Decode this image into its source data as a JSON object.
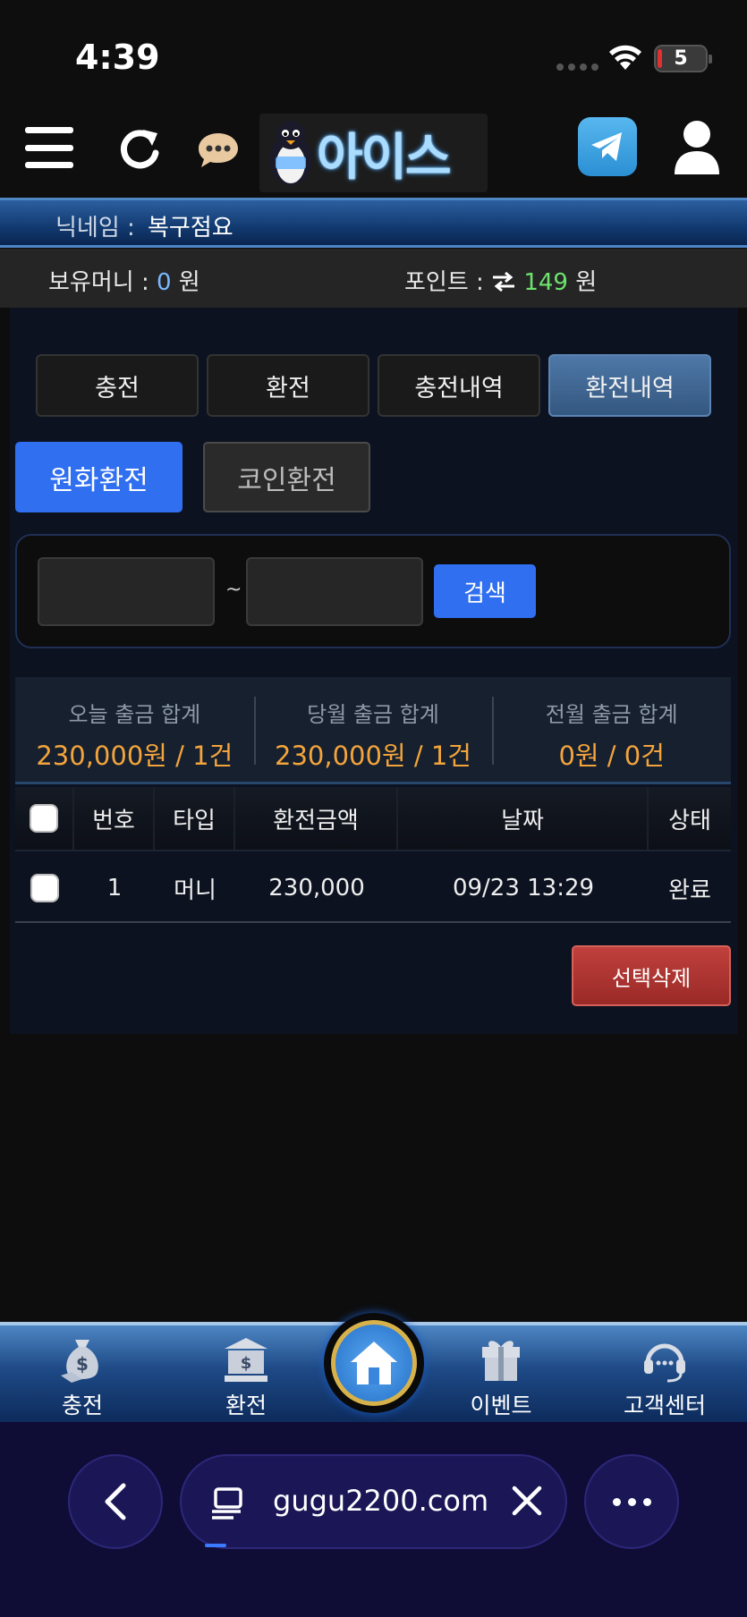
{
  "status_bar": {
    "time": "4:39",
    "battery": "5"
  },
  "header": {
    "logo_text": "아이스"
  },
  "user": {
    "nickname_label": "닉네임 :",
    "nickname": "복구점요"
  },
  "balance": {
    "money_label": "보유머니 :",
    "money_value": "0",
    "money_unit": "원",
    "point_label": "포인트 :",
    "point_value": "149",
    "point_unit": "원"
  },
  "tabs": [
    {
      "label": "충전",
      "active": false
    },
    {
      "label": "환전",
      "active": false
    },
    {
      "label": "충전내역",
      "active": false
    },
    {
      "label": "환전내역",
      "active": true
    }
  ],
  "subtabs": [
    {
      "label": "원화환전",
      "active": true
    },
    {
      "label": "코인환전",
      "active": false
    }
  ],
  "search": {
    "start_value": "",
    "separator": "~",
    "end_value": "",
    "button_label": "검색"
  },
  "summary": [
    {
      "label": "오늘 출금 합계",
      "value": "230,000원 / 1건"
    },
    {
      "label": "당월 출금 합계",
      "value": "230,000원 / 1건"
    },
    {
      "label": "전월 출금 합계",
      "value": "0원 / 0건"
    }
  ],
  "table": {
    "headers": [
      "번호",
      "타입",
      "환전금액",
      "날짜",
      "상태"
    ],
    "rows": [
      {
        "no": "1",
        "type": "머니",
        "amount": "230,000",
        "date": "09/23 13:29",
        "status": "완료"
      }
    ]
  },
  "delete_button": "선택삭제",
  "bottom_nav": {
    "items": [
      {
        "label": "충전",
        "icon": "money-bag-icon"
      },
      {
        "label": "환전",
        "icon": "bank-icon"
      },
      {
        "label": "",
        "icon": "home-icon"
      },
      {
        "label": "이벤트",
        "icon": "gift-icon"
      },
      {
        "label": "고객센터",
        "icon": "headset-icon"
      }
    ]
  },
  "browser": {
    "url": "gugu2200.com"
  },
  "colors": {
    "accent_blue": "#2f6ff0",
    "amount_orange": "#f4a43c",
    "point_green": "#6de36d",
    "delete_red": "#c0403c"
  }
}
